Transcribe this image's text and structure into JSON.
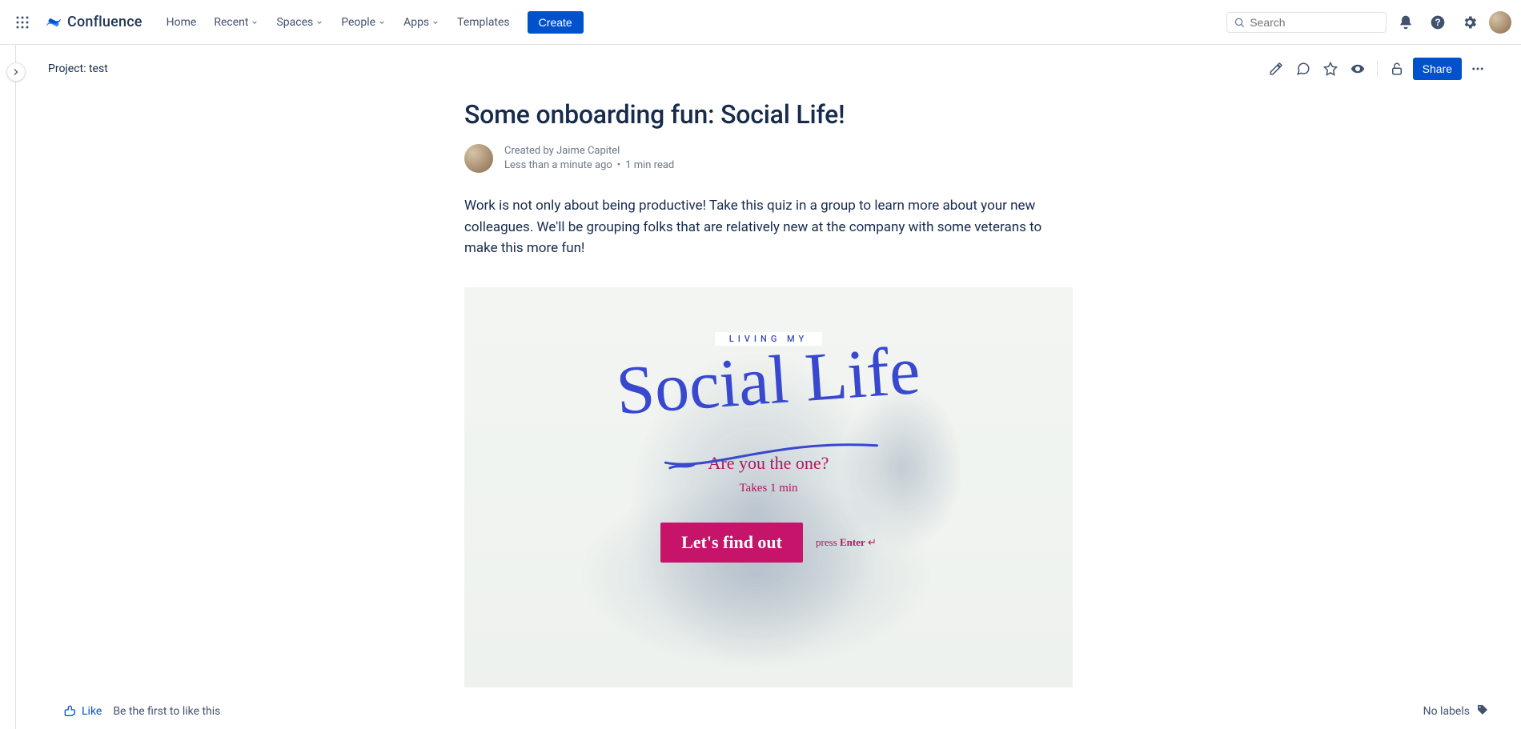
{
  "app": {
    "name": "Confluence"
  },
  "nav": {
    "home": "Home",
    "recent": "Recent",
    "spaces": "Spaces",
    "people": "People",
    "apps": "Apps",
    "templates": "Templates",
    "create": "Create"
  },
  "search": {
    "placeholder": "Search"
  },
  "breadcrumb": {
    "project": "Project: test"
  },
  "page_actions": {
    "share": "Share"
  },
  "page": {
    "title": "Some onboarding fun: Social Life!",
    "created_by_prefix": "Created by ",
    "author": "Jaime Capitel",
    "time_ago": "Less than a minute ago",
    "read_time": "1 min read",
    "body": "Work is not only about being productive! Take this quiz in a group to learn more about your new colleagues. We'll be grouping folks that are relatively new at the company with some veterans to make this more fun!"
  },
  "quiz": {
    "tag": "LIVING MY",
    "script": "Social Life",
    "subtitle": "Are you the one?",
    "time": "Takes 1 min",
    "cta": "Let's find out",
    "hint_prefix": "press ",
    "hint_key": "Enter",
    "hint_arrow": " ↵"
  },
  "footer": {
    "like": "Like",
    "like_meta": "Be the first to like this",
    "no_labels": "No labels"
  }
}
